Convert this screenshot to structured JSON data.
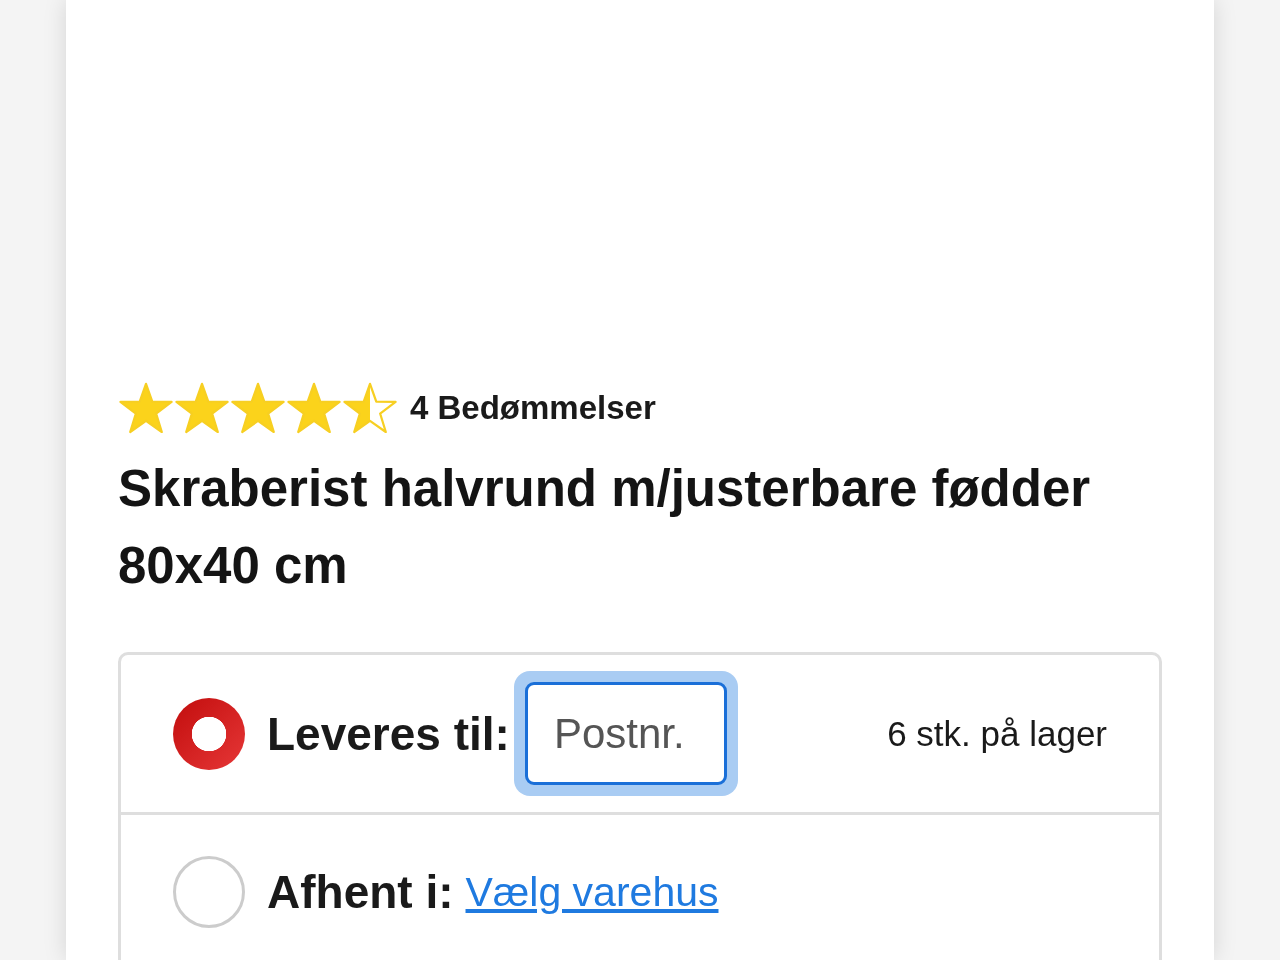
{
  "rating": {
    "stars": 4.5,
    "count_label": "4 Bedømmelser"
  },
  "product_title": "Skraberist halvrund m/justerbare fødder 80x40 cm",
  "delivery_options": [
    {
      "kind": "delivery",
      "selected": true,
      "label": "Leveres til:",
      "postcode_field": {
        "placeholder": "Postnr.",
        "focused": true
      },
      "stock": "6 stk. på lager"
    },
    {
      "kind": "pickup",
      "selected": false,
      "label": "Afhent i:",
      "link": "Vælg varehus"
    }
  ]
}
